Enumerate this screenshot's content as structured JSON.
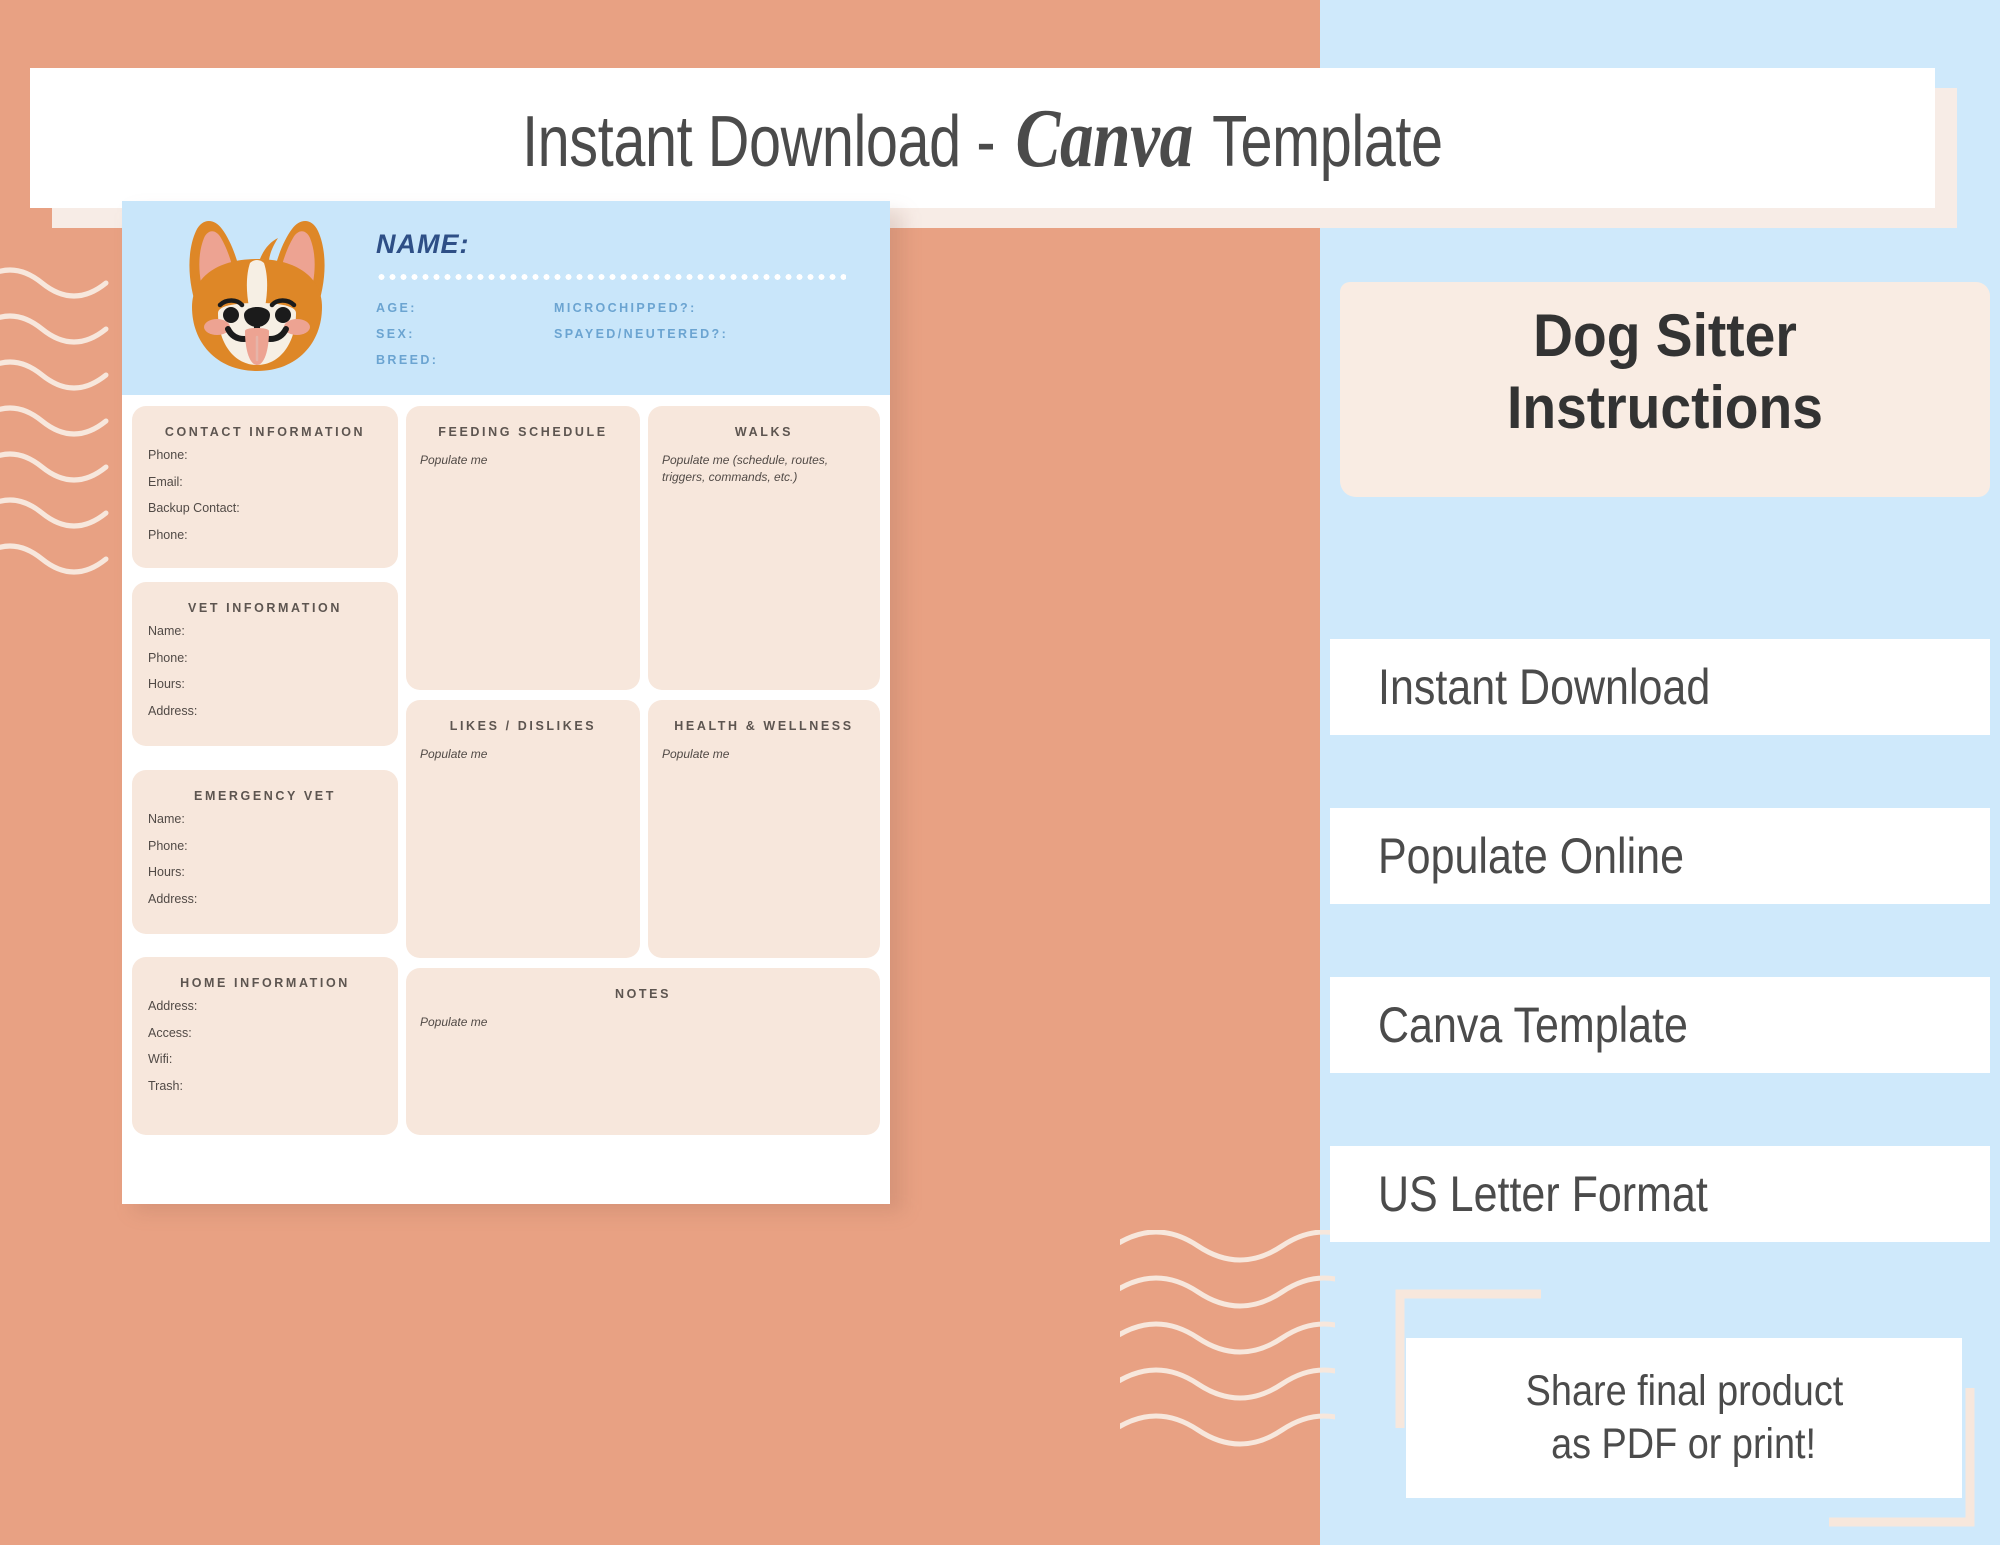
{
  "banner": {
    "prefix": "Instant Download - ",
    "brand": "Canva",
    "suffix": " Template"
  },
  "sheet": {
    "header": {
      "name_label": "NAME:",
      "fields_left": [
        "AGE:",
        "SEX:",
        "BREED:"
      ],
      "fields_right": [
        "MICROCHIPPED?:",
        "SPAYED/NEUTERED?:"
      ]
    },
    "panels": [
      {
        "key": "contact",
        "title": "CONTACT INFORMATION",
        "fields": [
          "Phone:",
          "Email:",
          "Backup Contact:",
          "Phone:"
        ],
        "note": ""
      },
      {
        "key": "vet",
        "title": "VET INFORMATION",
        "fields": [
          "Name:",
          "Phone:",
          "Hours:",
          "Address:"
        ],
        "note": ""
      },
      {
        "key": "emergency_vet",
        "title": "EMERGENCY VET",
        "fields": [
          "Name:",
          "Phone:",
          "Hours:",
          "Address:"
        ],
        "note": ""
      },
      {
        "key": "home",
        "title": "HOME INFORMATION",
        "fields": [
          "Address:",
          "Access:",
          "Wifi:",
          "Trash:"
        ],
        "note": ""
      },
      {
        "key": "feeding",
        "title": "FEEDING SCHEDULE",
        "fields": [],
        "note": "Populate me"
      },
      {
        "key": "walks",
        "title": "WALKS",
        "fields": [],
        "note": "Populate me (schedule, routes, triggers, commands, etc.)"
      },
      {
        "key": "likes",
        "title": "LIKES / DISLIKES",
        "fields": [],
        "note": "Populate me"
      },
      {
        "key": "health",
        "title": "HEALTH & WELLNESS",
        "fields": [],
        "note": "Populate me"
      },
      {
        "key": "notes",
        "title": "NOTES",
        "fields": [],
        "note": "Populate me"
      }
    ]
  },
  "right": {
    "title_line1": "Dog Sitter",
    "title_line2": "Instructions",
    "features": [
      "Instant Download",
      "Populate Online",
      "Canva Template",
      "US Letter Format"
    ],
    "final_line1": "Share final product",
    "final_line2": "as PDF or print!"
  },
  "colors": {
    "salmon": "#e8a183",
    "light_blue": "#cfe9fb",
    "sheet_blue": "#c9e6fa",
    "panel_beige": "#f7e7dc",
    "cream": "#f9ece3",
    "navy": "#2e4f86",
    "steel_blue": "#6ba4d1",
    "dark_text": "#4b4b4b",
    "dog_orange": "#de8727",
    "dog_pink": "#eda392",
    "dog_cream": "#f6efe4"
  }
}
